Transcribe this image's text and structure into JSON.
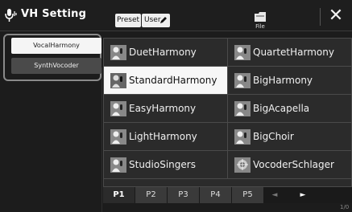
{
  "header": {
    "title": "VH Setting",
    "title_icon": "microphone-harmony-icon",
    "preset_label": "Preset",
    "user_label": "User",
    "file_label": "File",
    "close_label": "✕"
  },
  "categories": [
    {
      "label": "VocalHarmony",
      "selected": true
    },
    {
      "label": "SynthVocoder",
      "selected": false
    }
  ],
  "presets": [
    {
      "name": "DuetHarmony",
      "icon": "singer-icon"
    },
    {
      "name": "QuartetHarmony",
      "icon": "singer-icon"
    },
    {
      "name": "StandardHarmony",
      "icon": "singer-icon",
      "selected": true
    },
    {
      "name": "BigHarmony",
      "icon": "singer-icon"
    },
    {
      "name": "EasyHarmony",
      "icon": "singer-icon"
    },
    {
      "name": "BigAcapella",
      "icon": "singer-icon"
    },
    {
      "name": "LightHarmony",
      "icon": "singer-icon"
    },
    {
      "name": "BigChoir",
      "icon": "singer-icon"
    },
    {
      "name": "StudioSingers",
      "icon": "singer-icon"
    },
    {
      "name": "VocoderSchlager",
      "icon": "vocoder-icon"
    }
  ],
  "pages": {
    "tabs": [
      "P1",
      "P2",
      "P3",
      "P4",
      "P5"
    ],
    "active": "P1",
    "prev_label": "◄",
    "next_label": "►",
    "indicator": "1/0"
  },
  "colors": {
    "background": "#1c1c1c",
    "selected_cell": "#f7f7f7",
    "cell": "#2b2b2b"
  }
}
